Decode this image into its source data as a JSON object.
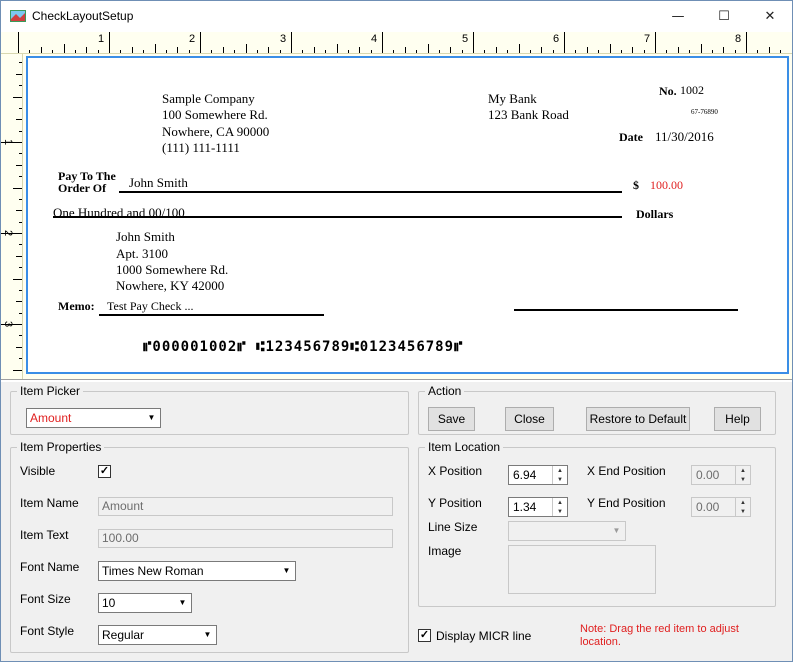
{
  "window": {
    "title": "CheckLayoutSetup",
    "minimize": "—",
    "maximize": "☐",
    "close": "✕"
  },
  "rulers": {
    "horizontal": [
      "1",
      "2",
      "3",
      "4",
      "5",
      "6",
      "7",
      "8"
    ],
    "vertical": [
      "1",
      "2",
      "3"
    ]
  },
  "check": {
    "company": [
      "Sample Company",
      "100 Somewhere Rd.",
      "Nowhere, CA 90000",
      "(111) 111-1111"
    ],
    "bank": [
      "My Bank",
      "123 Bank Road"
    ],
    "number_label": "No.",
    "number": "1002",
    "routing_fraction": "67-76890",
    "date_label": "Date",
    "date": "11/30/2016",
    "payto_label_1": "Pay To The",
    "payto_label_2": "Order Of",
    "payee": "John Smith",
    "dollar_sign": "$",
    "amount": "100.00",
    "amount_words": "One Hundred  and 00/100",
    "dollars_label": "Dollars",
    "address": [
      "John Smith",
      "Apt. 3100",
      "1000 Somewhere Rd.",
      "Nowhere, KY 42000"
    ],
    "memo_label": "Memo:",
    "memo": "Test Pay Check ...",
    "micr": "⑈000001002⑈ ⑆123456789⑆0123456789⑈"
  },
  "item_picker": {
    "label": "Item Picker",
    "selected": "Amount"
  },
  "action": {
    "label": "Action",
    "save": "Save",
    "close": "Close",
    "restore": "Restore to Default",
    "help": "Help"
  },
  "item_properties": {
    "label": "Item Properties",
    "visible_label": "Visible",
    "visible_checked": "✓",
    "item_name_label": "Item Name",
    "item_name": "Amount",
    "item_text_label": "Item Text",
    "item_text": "100.00",
    "font_name_label": "Font Name",
    "font_name": "Times New Roman",
    "font_size_label": "Font Size",
    "font_size": "10",
    "font_style_label": "Font Style",
    "font_style": "Regular"
  },
  "item_location": {
    "label": "Item Location",
    "x_label": "X Position",
    "x_value": "6.94",
    "y_label": "Y Position",
    "y_value": "1.34",
    "x_end_label": "X End Position",
    "x_end_value": "0.00",
    "y_end_label": "Y End Position",
    "y_end_value": "0.00",
    "line_size_label": "Line Size",
    "image_label": "Image"
  },
  "footer": {
    "micr_checked": "✓",
    "micr_label": "Display MICR line",
    "note": "Note:  Drag the red item to adjust location."
  },
  "colors": {
    "accent": "#3a8ee6",
    "note_red": "#e02020"
  }
}
